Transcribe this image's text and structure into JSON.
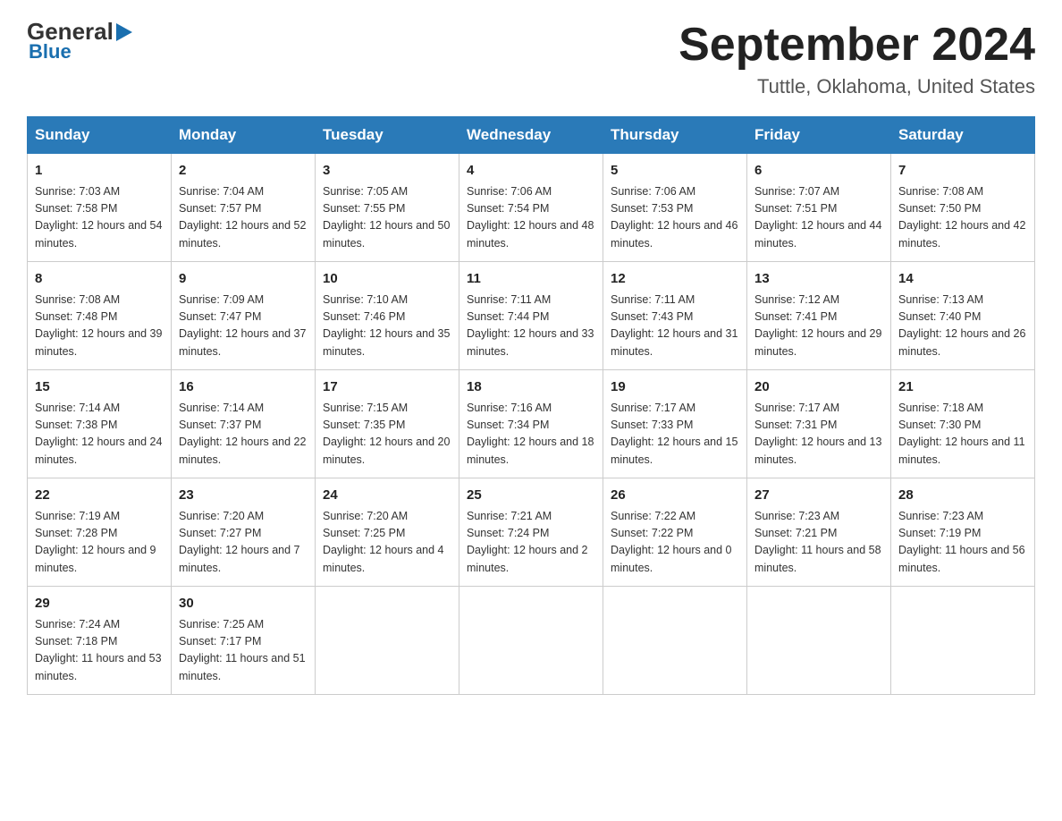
{
  "header": {
    "month_title": "September 2024",
    "location": "Tuttle, Oklahoma, United States"
  },
  "logo": {
    "part1": "General",
    "part2": "Blue"
  },
  "days_of_week": [
    "Sunday",
    "Monday",
    "Tuesday",
    "Wednesday",
    "Thursday",
    "Friday",
    "Saturday"
  ],
  "weeks": [
    [
      {
        "day": "1",
        "sunrise": "Sunrise: 7:03 AM",
        "sunset": "Sunset: 7:58 PM",
        "daylight": "Daylight: 12 hours and 54 minutes."
      },
      {
        "day": "2",
        "sunrise": "Sunrise: 7:04 AM",
        "sunset": "Sunset: 7:57 PM",
        "daylight": "Daylight: 12 hours and 52 minutes."
      },
      {
        "day": "3",
        "sunrise": "Sunrise: 7:05 AM",
        "sunset": "Sunset: 7:55 PM",
        "daylight": "Daylight: 12 hours and 50 minutes."
      },
      {
        "day": "4",
        "sunrise": "Sunrise: 7:06 AM",
        "sunset": "Sunset: 7:54 PM",
        "daylight": "Daylight: 12 hours and 48 minutes."
      },
      {
        "day": "5",
        "sunrise": "Sunrise: 7:06 AM",
        "sunset": "Sunset: 7:53 PM",
        "daylight": "Daylight: 12 hours and 46 minutes."
      },
      {
        "day": "6",
        "sunrise": "Sunrise: 7:07 AM",
        "sunset": "Sunset: 7:51 PM",
        "daylight": "Daylight: 12 hours and 44 minutes."
      },
      {
        "day": "7",
        "sunrise": "Sunrise: 7:08 AM",
        "sunset": "Sunset: 7:50 PM",
        "daylight": "Daylight: 12 hours and 42 minutes."
      }
    ],
    [
      {
        "day": "8",
        "sunrise": "Sunrise: 7:08 AM",
        "sunset": "Sunset: 7:48 PM",
        "daylight": "Daylight: 12 hours and 39 minutes."
      },
      {
        "day": "9",
        "sunrise": "Sunrise: 7:09 AM",
        "sunset": "Sunset: 7:47 PM",
        "daylight": "Daylight: 12 hours and 37 minutes."
      },
      {
        "day": "10",
        "sunrise": "Sunrise: 7:10 AM",
        "sunset": "Sunset: 7:46 PM",
        "daylight": "Daylight: 12 hours and 35 minutes."
      },
      {
        "day": "11",
        "sunrise": "Sunrise: 7:11 AM",
        "sunset": "Sunset: 7:44 PM",
        "daylight": "Daylight: 12 hours and 33 minutes."
      },
      {
        "day": "12",
        "sunrise": "Sunrise: 7:11 AM",
        "sunset": "Sunset: 7:43 PM",
        "daylight": "Daylight: 12 hours and 31 minutes."
      },
      {
        "day": "13",
        "sunrise": "Sunrise: 7:12 AM",
        "sunset": "Sunset: 7:41 PM",
        "daylight": "Daylight: 12 hours and 29 minutes."
      },
      {
        "day": "14",
        "sunrise": "Sunrise: 7:13 AM",
        "sunset": "Sunset: 7:40 PM",
        "daylight": "Daylight: 12 hours and 26 minutes."
      }
    ],
    [
      {
        "day": "15",
        "sunrise": "Sunrise: 7:14 AM",
        "sunset": "Sunset: 7:38 PM",
        "daylight": "Daylight: 12 hours and 24 minutes."
      },
      {
        "day": "16",
        "sunrise": "Sunrise: 7:14 AM",
        "sunset": "Sunset: 7:37 PM",
        "daylight": "Daylight: 12 hours and 22 minutes."
      },
      {
        "day": "17",
        "sunrise": "Sunrise: 7:15 AM",
        "sunset": "Sunset: 7:35 PM",
        "daylight": "Daylight: 12 hours and 20 minutes."
      },
      {
        "day": "18",
        "sunrise": "Sunrise: 7:16 AM",
        "sunset": "Sunset: 7:34 PM",
        "daylight": "Daylight: 12 hours and 18 minutes."
      },
      {
        "day": "19",
        "sunrise": "Sunrise: 7:17 AM",
        "sunset": "Sunset: 7:33 PM",
        "daylight": "Daylight: 12 hours and 15 minutes."
      },
      {
        "day": "20",
        "sunrise": "Sunrise: 7:17 AM",
        "sunset": "Sunset: 7:31 PM",
        "daylight": "Daylight: 12 hours and 13 minutes."
      },
      {
        "day": "21",
        "sunrise": "Sunrise: 7:18 AM",
        "sunset": "Sunset: 7:30 PM",
        "daylight": "Daylight: 12 hours and 11 minutes."
      }
    ],
    [
      {
        "day": "22",
        "sunrise": "Sunrise: 7:19 AM",
        "sunset": "Sunset: 7:28 PM",
        "daylight": "Daylight: 12 hours and 9 minutes."
      },
      {
        "day": "23",
        "sunrise": "Sunrise: 7:20 AM",
        "sunset": "Sunset: 7:27 PM",
        "daylight": "Daylight: 12 hours and 7 minutes."
      },
      {
        "day": "24",
        "sunrise": "Sunrise: 7:20 AM",
        "sunset": "Sunset: 7:25 PM",
        "daylight": "Daylight: 12 hours and 4 minutes."
      },
      {
        "day": "25",
        "sunrise": "Sunrise: 7:21 AM",
        "sunset": "Sunset: 7:24 PM",
        "daylight": "Daylight: 12 hours and 2 minutes."
      },
      {
        "day": "26",
        "sunrise": "Sunrise: 7:22 AM",
        "sunset": "Sunset: 7:22 PM",
        "daylight": "Daylight: 12 hours and 0 minutes."
      },
      {
        "day": "27",
        "sunrise": "Sunrise: 7:23 AM",
        "sunset": "Sunset: 7:21 PM",
        "daylight": "Daylight: 11 hours and 58 minutes."
      },
      {
        "day": "28",
        "sunrise": "Sunrise: 7:23 AM",
        "sunset": "Sunset: 7:19 PM",
        "daylight": "Daylight: 11 hours and 56 minutes."
      }
    ],
    [
      {
        "day": "29",
        "sunrise": "Sunrise: 7:24 AM",
        "sunset": "Sunset: 7:18 PM",
        "daylight": "Daylight: 11 hours and 53 minutes."
      },
      {
        "day": "30",
        "sunrise": "Sunrise: 7:25 AM",
        "sunset": "Sunset: 7:17 PM",
        "daylight": "Daylight: 11 hours and 51 minutes."
      },
      null,
      null,
      null,
      null,
      null
    ]
  ]
}
